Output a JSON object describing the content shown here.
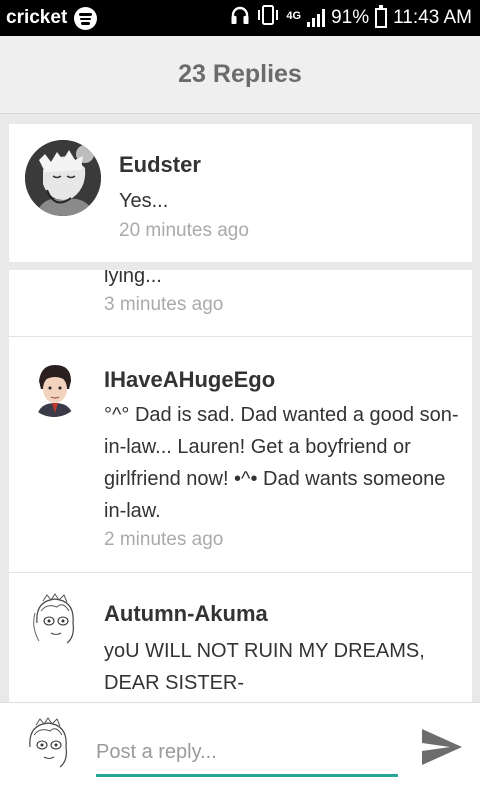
{
  "status_bar": {
    "carrier": "cricket",
    "network": "4G",
    "battery": "91%",
    "time": "11:43 AM"
  },
  "header": {
    "title": "23 Replies"
  },
  "comments": [
    {
      "username": "Eudster",
      "text": "Yes...",
      "time": "20 minutes ago"
    },
    {
      "username": "",
      "text": "lying...",
      "time": "3 minutes ago"
    },
    {
      "username": "IHaveAHugeEgo",
      "text": "°^° Dad is sad. Dad wanted a good son-in-law... Lauren! Get a boyfriend or girlfriend now! •^• Dad wants someone in-law.",
      "time": "2 minutes ago"
    },
    {
      "username": "Autumn-Akuma",
      "text": "yoU WILL NOT RUIN MY DREAMS, DEAR SISTER-",
      "time": ""
    }
  ],
  "composer": {
    "placeholder": "Post a reply..."
  },
  "icons": {
    "spotify": "spotify-icon",
    "headphones": "headphones-icon",
    "vibrate": "vibrate-icon",
    "signal": "signal-icon",
    "battery": "battery-icon",
    "send": "send-icon"
  }
}
